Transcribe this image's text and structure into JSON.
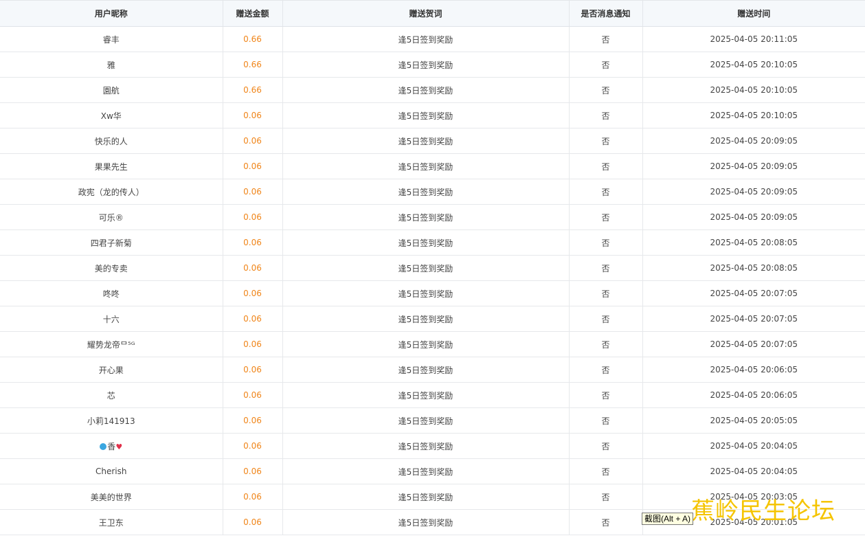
{
  "table": {
    "columns": [
      "用户昵称",
      "赠送金额",
      "赠送贺词",
      "是否消息通知",
      "赠送时间"
    ],
    "rows": [
      {
        "name": "睿丰",
        "amount": "0.66",
        "message": "逢5日签到奖励",
        "notify": "否",
        "time": "2025-04-05 20:11:05"
      },
      {
        "name": "雅",
        "amount": "0.66",
        "message": "逢5日签到奖励",
        "notify": "否",
        "time": "2025-04-05 20:10:05"
      },
      {
        "name": "園航",
        "amount": "0.66",
        "message": "逢5日签到奖励",
        "notify": "否",
        "time": "2025-04-05 20:10:05"
      },
      {
        "name": "Xw华",
        "amount": "0.06",
        "message": "逢5日签到奖励",
        "notify": "否",
        "time": "2025-04-05 20:10:05"
      },
      {
        "name": "快乐的人",
        "amount": "0.06",
        "message": "逢5日签到奖励",
        "notify": "否",
        "time": "2025-04-05 20:09:05"
      },
      {
        "name": "果果先生",
        "amount": "0.06",
        "message": "逢5日签到奖励",
        "notify": "否",
        "time": "2025-04-05 20:09:05"
      },
      {
        "name": "政宪（龙的传人）",
        "amount": "0.06",
        "message": "逢5日签到奖励",
        "notify": "否",
        "time": "2025-04-05 20:09:05"
      },
      {
        "name": "可乐®",
        "amount": "0.06",
        "message": "逢5日签到奖励",
        "notify": "否",
        "time": "2025-04-05 20:09:05"
      },
      {
        "name": "四君子新菊",
        "amount": "0.06",
        "message": "逢5日签到奖励",
        "notify": "否",
        "time": "2025-04-05 20:08:05"
      },
      {
        "name": "美的专卖",
        "amount": "0.06",
        "message": "逢5日签到奖励",
        "notify": "否",
        "time": "2025-04-05 20:08:05"
      },
      {
        "name": "咚咚",
        "amount": "0.06",
        "message": "逢5日签到奖励",
        "notify": "否",
        "time": "2025-04-05 20:07:05"
      },
      {
        "name": "十六",
        "amount": "0.06",
        "message": "逢5日签到奖励",
        "notify": "否",
        "time": "2025-04-05 20:07:05"
      },
      {
        "name": "耀势龙帝ᄆ⁵ᴳ",
        "amount": "0.06",
        "message": "逢5日签到奖励",
        "notify": "否",
        "time": "2025-04-05 20:07:05"
      },
      {
        "name": "开心果",
        "amount": "0.06",
        "message": "逢5日签到奖励",
        "notify": "否",
        "time": "2025-04-05 20:06:05"
      },
      {
        "name": "芯",
        "amount": "0.06",
        "message": "逢5日签到奖励",
        "notify": "否",
        "time": "2025-04-05 20:06:05"
      },
      {
        "name": "小莉141913",
        "amount": "0.06",
        "message": "逢5日签到奖励",
        "notify": "否",
        "time": "2025-04-05 20:05:05"
      },
      {
        "name": "香",
        "amount": "0.06",
        "message": "逢5日签到奖励",
        "notify": "否",
        "time": "2025-04-05 20:04:05",
        "emoji": true
      },
      {
        "name": "Cherish",
        "amount": "0.06",
        "message": "逢5日签到奖励",
        "notify": "否",
        "time": "2025-04-05 20:04:05"
      },
      {
        "name": "美美的世界",
        "amount": "0.06",
        "message": "逢5日签到奖励",
        "notify": "否",
        "time": "2025-04-05 20:03:05"
      },
      {
        "name": "王卫东",
        "amount": "0.06",
        "message": "逢5日签到奖励",
        "notify": "否",
        "time": "2025-04-05 20:01:05"
      }
    ]
  },
  "tooltip": {
    "text": "截图(Alt + A)"
  },
  "watermark": {
    "text": "蕉岭民生论坛"
  },
  "colors": {
    "amount": "#f08519",
    "header_bg": "#f5f8fb",
    "watermark": "#f5c400"
  }
}
